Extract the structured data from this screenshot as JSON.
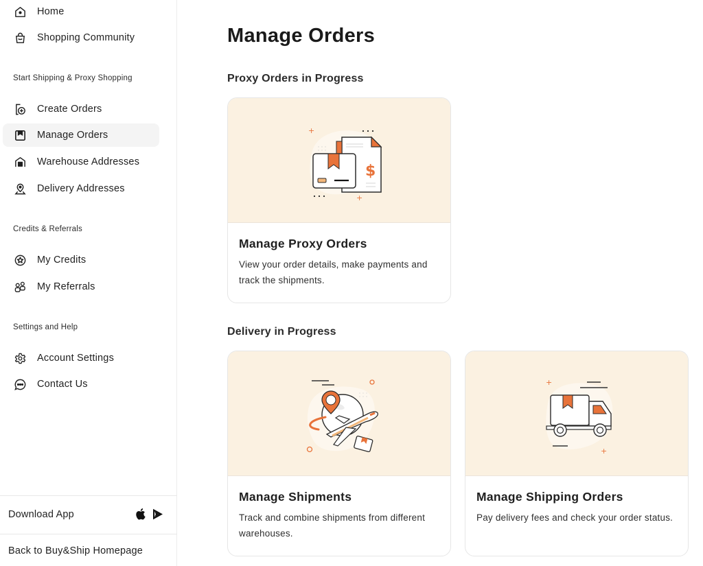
{
  "sidebar": {
    "top_items": [
      {
        "label": "Home",
        "icon": "home-icon"
      },
      {
        "label": "Shopping Community",
        "icon": "shopping-bag-icon"
      }
    ],
    "sections": [
      {
        "title": "Start Shipping & Proxy Shopping",
        "items": [
          {
            "label": "Create Orders",
            "icon": "create-order-icon"
          },
          {
            "label": "Manage Orders",
            "icon": "bookmark-box-icon",
            "active": true
          },
          {
            "label": "Warehouse Addresses",
            "icon": "warehouse-icon"
          },
          {
            "label": "Delivery Addresses",
            "icon": "location-pin-icon"
          }
        ]
      },
      {
        "title": "Credits & Referrals",
        "items": [
          {
            "label": "My Credits",
            "icon": "star-badge-icon"
          },
          {
            "label": "My Referrals",
            "icon": "users-icon"
          }
        ]
      },
      {
        "title": "Settings and Help",
        "items": [
          {
            "label": "Account Settings",
            "icon": "gear-icon"
          },
          {
            "label": "Contact Us",
            "icon": "chat-bubble-icon"
          }
        ]
      }
    ],
    "download_app": "Download App",
    "store_icons": [
      "apple-icon",
      "google-play-icon"
    ],
    "back_link": "Back to Buy&Ship Homepage"
  },
  "main": {
    "title": "Manage Orders",
    "sections": [
      {
        "title": "Proxy Orders in Progress",
        "cards": [
          {
            "title": "Manage Proxy Orders",
            "description": "View your order details, make payments and track the shipments.",
            "illustration": "package-invoice-illustration"
          }
        ]
      },
      {
        "title": "Delivery in Progress",
        "cards": [
          {
            "title": "Manage Shipments",
            "description": "Track and combine shipments from different warehouses.",
            "illustration": "airplane-globe-illustration"
          },
          {
            "title": "Manage Shipping Orders",
            "description": "Pay delivery fees and check your order status.",
            "illustration": "delivery-truck-illustration"
          }
        ]
      }
    ]
  },
  "colors": {
    "accent": "#e8733a",
    "hero_background": "#fbf1e1",
    "active_nav_background": "#f4f4f4"
  }
}
